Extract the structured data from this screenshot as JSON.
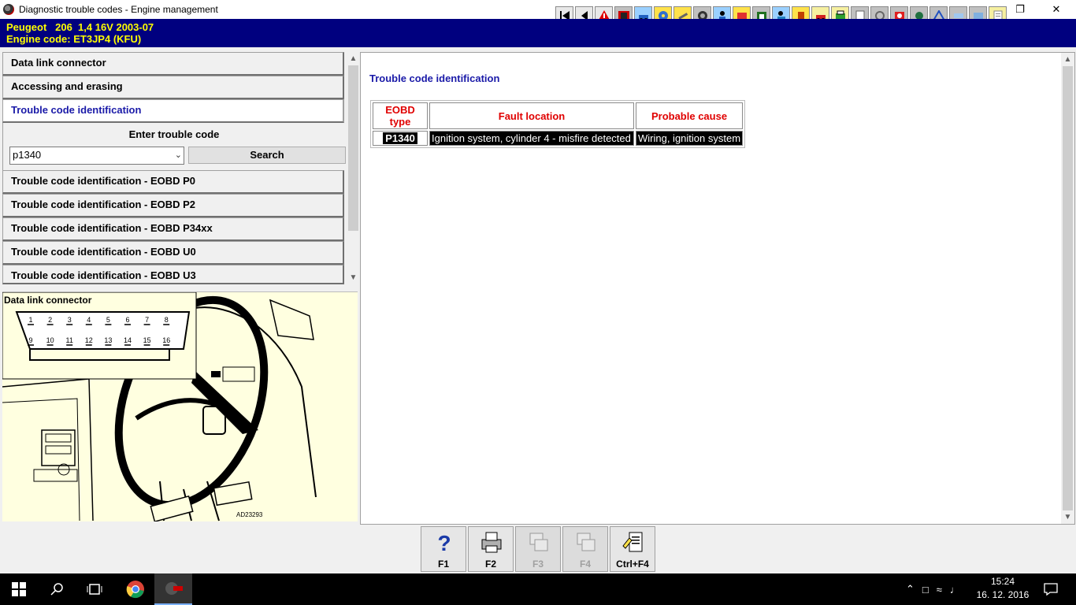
{
  "window": {
    "title": "Diagnostic trouble codes - Engine management",
    "restore_glyph": "❐",
    "close_glyph": "✕"
  },
  "toolbar": {
    "icons": [
      "first-icon",
      "back-icon",
      "warning-icon",
      "info-icon",
      "vehicle-icon",
      "engine-icon",
      "tool-icon",
      "wheel-icon",
      "person-icon",
      "paint-icon",
      "building-icon",
      "mechanic-icon",
      "fuel-icon",
      "car-icon",
      "printer-icon",
      "document-icon",
      "component-icon",
      "disc-icon",
      "wiring-icon",
      "sensor-icon",
      "airbag-icon",
      "aircon-icon",
      "notes-icon"
    ]
  },
  "vehicle": {
    "line1": "Peugeot   206  1,4 16V 2003-07",
    "line2": "Engine code: ET3JP4 (KFU)"
  },
  "nav": {
    "items": [
      {
        "label": "Data link connector"
      },
      {
        "label": "Accessing and erasing"
      },
      {
        "label": "Trouble code identification"
      },
      {
        "label": "Trouble code identification - EOBD P0"
      },
      {
        "label": "Trouble code identification - EOBD P2"
      },
      {
        "label": "Trouble code identification - EOBD P34xx"
      },
      {
        "label": "Trouble code identification - EOBD U0"
      },
      {
        "label": "Trouble code identification - EOBD U3"
      }
    ]
  },
  "search": {
    "label": "Enter trouble code",
    "value": "p1340",
    "button": "Search"
  },
  "diagram": {
    "title": "Data link connector",
    "pins_top": [
      "1",
      "2",
      "3",
      "4",
      "5",
      "6",
      "7",
      "8"
    ],
    "pins_bottom": [
      "9",
      "10",
      "11",
      "12",
      "13",
      "14",
      "15",
      "16"
    ],
    "ref": "AD23293"
  },
  "main": {
    "title": "Trouble code identification",
    "columns": [
      "EOBD type",
      "Fault location",
      "Probable cause"
    ],
    "rows": [
      {
        "code": "P1340",
        "location": "Ignition system, cylinder 4 - misfire detected",
        "cause": "Wiring, ignition system"
      }
    ]
  },
  "fkeys": [
    {
      "label": "F1",
      "icon": "help-icon",
      "enabled": true
    },
    {
      "label": "F2",
      "icon": "printer-icon",
      "enabled": true
    },
    {
      "label": "F3",
      "icon": "copy-icon",
      "enabled": false
    },
    {
      "label": "F4",
      "icon": "copy-all-icon",
      "enabled": false
    },
    {
      "label": "Ctrl+F4",
      "icon": "notes-icon",
      "enabled": true
    }
  ],
  "taskbar": {
    "time": "15:24",
    "date": "16. 12. 2016"
  }
}
